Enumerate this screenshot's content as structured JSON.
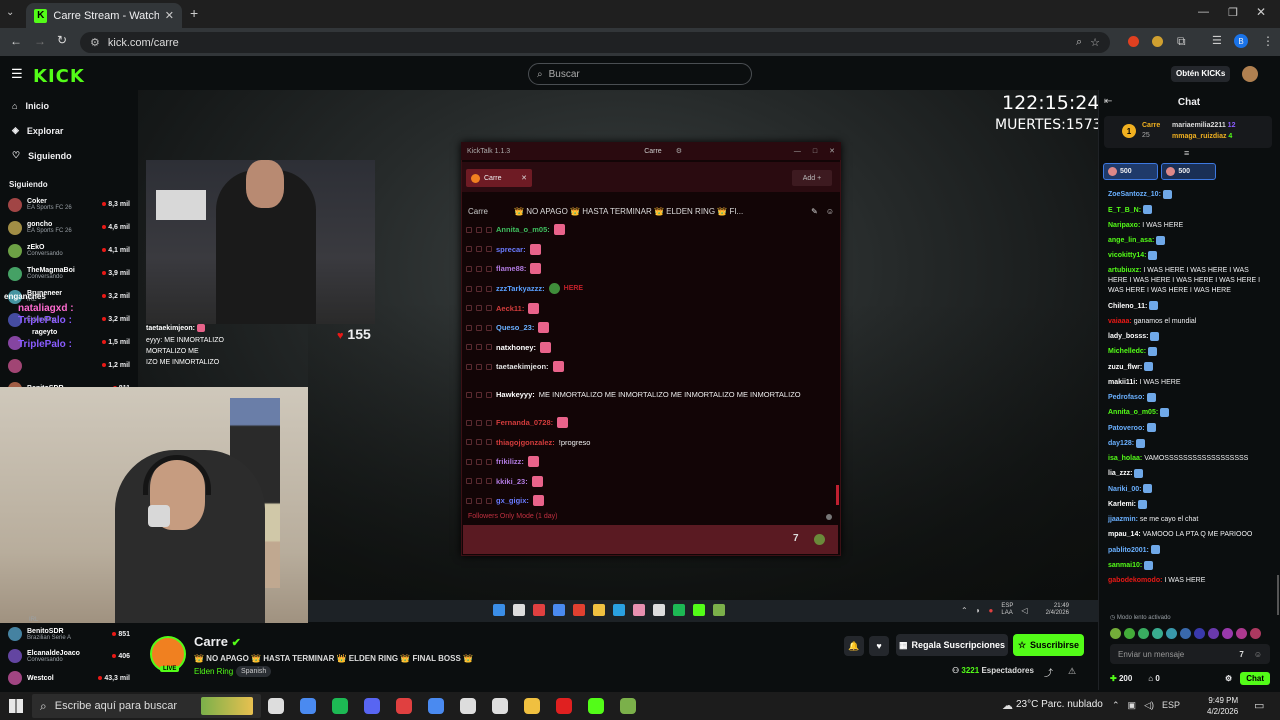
{
  "browser": {
    "tab_title": "Carre Stream - Watch Live o",
    "url": "kick.com/carre",
    "profile_initial": "B"
  },
  "kick": {
    "logo": "KICK",
    "search_placeholder": "Buscar",
    "get_kicks": "Obtén KICKs"
  },
  "nav": {
    "items": [
      {
        "label": "Inicio",
        "icon": "home-icon"
      },
      {
        "label": "Explorar",
        "icon": "compass-icon"
      },
      {
        "label": "Siguiendo",
        "icon": "heart-icon"
      }
    ],
    "following_header": "Siguiendo",
    "following": [
      {
        "name": "Coker",
        "sub": "EA Sports FC 26",
        "count": "8,3 mil"
      },
      {
        "name": "goncho",
        "sub": "EA Sports FC 26",
        "count": "4,6 mil"
      },
      {
        "name": "zEkO",
        "sub": "Conversando",
        "count": "4,1 mil"
      },
      {
        "name": "TheMagmaBoi",
        "sub": "Conversando",
        "count": "3,9 mil"
      },
      {
        "name": "Bruneneer",
        "sub": "IRL",
        "count": "3,2 mil"
      },
      {
        "name": "",
        "sub": "Elden Ring",
        "count": "3,2 mil"
      },
      {
        "name": "",
        "sub": "",
        "count": "1,5 mil"
      },
      {
        "name": "",
        "sub": "",
        "count": "1,2 mil"
      },
      {
        "name": "BenitoSDR",
        "sub": "",
        "count": "811"
      }
    ],
    "following_bottom": [
      {
        "name": "BenitoSDR",
        "sub": "Brazilian Serie A",
        "count": "851"
      },
      {
        "name": "ElcanaldeJoaco",
        "sub": "Conversando",
        "count": "406"
      },
      {
        "name": "Westcol",
        "sub": "",
        "count": "43,3 mil"
      }
    ],
    "irl_label": "IRL"
  },
  "stream_overlay": {
    "timer": "122:15:24",
    "deaths": "MUERTES:1573",
    "cam_chat": [
      {
        "user": "taetaekimjeon:",
        "text": ""
      },
      {
        "user": "",
        "text": "eyyy: ME INMORTALIZO"
      },
      {
        "user": "",
        "text": "MORTALIZO      ME"
      },
      {
        "user": "",
        "text": "IZO      ME INMORTALIZO"
      }
    ],
    "heart_count": "155",
    "side_names": [
      "enganches",
      "nataliagxd :",
      "TriplePalo :",
      "TriplePalo :",
      "rageyto"
    ]
  },
  "kicktalk": {
    "title": "KickTalk 1.1.3",
    "tab_center": "Carre",
    "tab_label": "Carre",
    "add_label": "Add",
    "channel": "Carre",
    "stream_title": "👑 NO APAGO 👑 HASTA TERMINAR 👑 ELDEN RING 👑 FI...",
    "messages": [
      {
        "user": "Annita_o_m05:",
        "color": "#3fbf5f",
        "text": "",
        "emotes": [
          "pink"
        ]
      },
      {
        "user": "sprecar:",
        "color": "#6a7bff",
        "text": "",
        "emotes": [
          "pink"
        ]
      },
      {
        "user": "flame88:",
        "color": "#b07adf",
        "text": "",
        "emotes": [
          "pink"
        ]
      },
      {
        "user": "zzzTarkyazzz:",
        "color": "#5aa0ff",
        "text": "",
        "emotes": [
          "pepe",
          "here"
        ]
      },
      {
        "user": "Aeck11:",
        "color": "#d23c3c",
        "text": "",
        "emotes": [
          "pink"
        ]
      },
      {
        "user": "Queso_23:",
        "color": "#6ab0ff",
        "text": "",
        "emotes": [
          "pink"
        ]
      },
      {
        "user": "natxhoney:",
        "color": "#ffffff",
        "text": "",
        "emotes": [
          "pink"
        ]
      },
      {
        "user": "taetaekimjeon:",
        "color": "#e0e0e0",
        "text": "",
        "emotes": [
          "pink"
        ]
      },
      {
        "user": "Hawkeyyy:",
        "color": "#ffffff",
        "text": "ME INMORTALIZO      ME INMORTALIZO      ME INMORTALIZO      ME INMORTALIZO",
        "emotes": []
      },
      {
        "user": "Fernanda_0728:",
        "color": "#d23c3c",
        "text": "",
        "emotes": [
          "pink"
        ]
      },
      {
        "user": "thiagojgonzalez:",
        "color": "#d23c3c",
        "text": "!progreso",
        "emotes": []
      },
      {
        "user": "frikilizz:",
        "color": "#b07adf",
        "text": "",
        "emotes": [
          "pink"
        ]
      },
      {
        "user": "kkiki_23:",
        "color": "#b07adf",
        "text": "",
        "emotes": [
          "pink"
        ]
      },
      {
        "user": "gx_gigix:",
        "color": "#6a7bff",
        "text": "",
        "emotes": [
          "pink"
        ]
      }
    ],
    "followers_mode": "Followers Only Mode (1 day)"
  },
  "stream_taskbar": {
    "lang": "ESP",
    "lang2": "LAA",
    "time": "21:49",
    "date": "2/4/2026"
  },
  "streamer": {
    "name": "Carre",
    "title": "👑 NO APAGO 👑 HASTA TERMINAR 👑 ELDEN RING 👑 FINAL BOSS 👑",
    "game": "Elden Ring",
    "language": "Spanish",
    "live_badge": "LIVE",
    "gift_subs": "Regala Suscripciones",
    "subscribe": "Suscribirse",
    "viewers": "3221",
    "viewers_label": "Espectadores"
  },
  "chat": {
    "header": "Chat",
    "pinned": [
      {
        "user": "Carre",
        "count": "25"
      },
      {
        "user": "mariaemilia2211",
        "count": "12"
      },
      {
        "user": "mmaga_ruizdiaz",
        "count": "4"
      }
    ],
    "pinned_rank": "1",
    "gift_amounts": [
      "500",
      "500"
    ],
    "messages": [
      {
        "user": "ZoeSantozz_10:",
        "color": "#6ab0ff",
        "text": ""
      },
      {
        "user": "E_T_B_N:",
        "color": "#53fc18",
        "text": ""
      },
      {
        "user": "Naripaxo:",
        "color": "#53fc18",
        "text": "I WAS HERE"
      },
      {
        "user": "ange_lin_asa:",
        "color": "#53fc18",
        "text": ""
      },
      {
        "user": "vicokitty14:",
        "color": "#53fc18",
        "text": ""
      },
      {
        "user": "artubiuxz:",
        "color": "#53fc18",
        "text": "I WAS HERE   I WAS HERE   I WAS HERE   I WAS HERE   I WAS HERE   I WAS HERE   I WAS HERE   I WAS HERE   I WAS HERE"
      },
      {
        "user": "Chileno_11:",
        "color": "#ffffff",
        "text": ""
      },
      {
        "user": "vaiaaa:",
        "color": "#e91916",
        "text": "ganamos el mundial"
      },
      {
        "user": "lady_bosss:",
        "color": "#ffffff",
        "text": ""
      },
      {
        "user": "Michelledc:",
        "color": "#53fc18",
        "text": ""
      },
      {
        "user": "zuzu_flwr:",
        "color": "#ffffff",
        "text": ""
      },
      {
        "user": "makii11i:",
        "color": "#ffffff",
        "text": "I WAS HERE"
      },
      {
        "user": "Pedrofaso:",
        "color": "#6ab0ff",
        "text": ""
      },
      {
        "user": "Annita_o_m05:",
        "color": "#53fc18",
        "text": ""
      },
      {
        "user": "Patoveroo:",
        "color": "#6ab0ff",
        "text": ""
      },
      {
        "user": "day128:",
        "color": "#6ab0ff",
        "text": ""
      },
      {
        "user": "isa_holaa:",
        "color": "#53fc18",
        "text": "VAMOSSSSSSSSSSSSSSSSSS"
      },
      {
        "user": "lia_zzz:",
        "color": "#ffffff",
        "text": ""
      },
      {
        "user": "Nariki_00:",
        "color": "#6ab0ff",
        "text": ""
      },
      {
        "user": "Karlemi:",
        "color": "#ffffff",
        "text": ""
      },
      {
        "user": "jjaazmin:",
        "color": "#6ab0ff",
        "text": "se me cayo el chat"
      },
      {
        "user": "mpau_14:",
        "color": "#ffffff",
        "text": "VAMOOO LA PTA Q ME PARIOOO"
      },
      {
        "user": "pablito2001:",
        "color": "#6ab0ff",
        "text": ""
      },
      {
        "user": "sanmai10:",
        "color": "#53fc18",
        "text": ""
      },
      {
        "user": "gabodekomodo:",
        "color": "#e91916",
        "text": "I WAS HERE"
      }
    ],
    "slow_mode": "Modo lento activado",
    "input_placeholder": "Enviar un mensaje",
    "points": "200",
    "count2": "0",
    "send": "Chat"
  },
  "taskbar": {
    "search_placeholder": "Escribe aquí para buscar",
    "weather": "23°C  Parc. nublado",
    "lang": "ESP",
    "time": "9:49 PM",
    "date": "4/2/2026"
  }
}
